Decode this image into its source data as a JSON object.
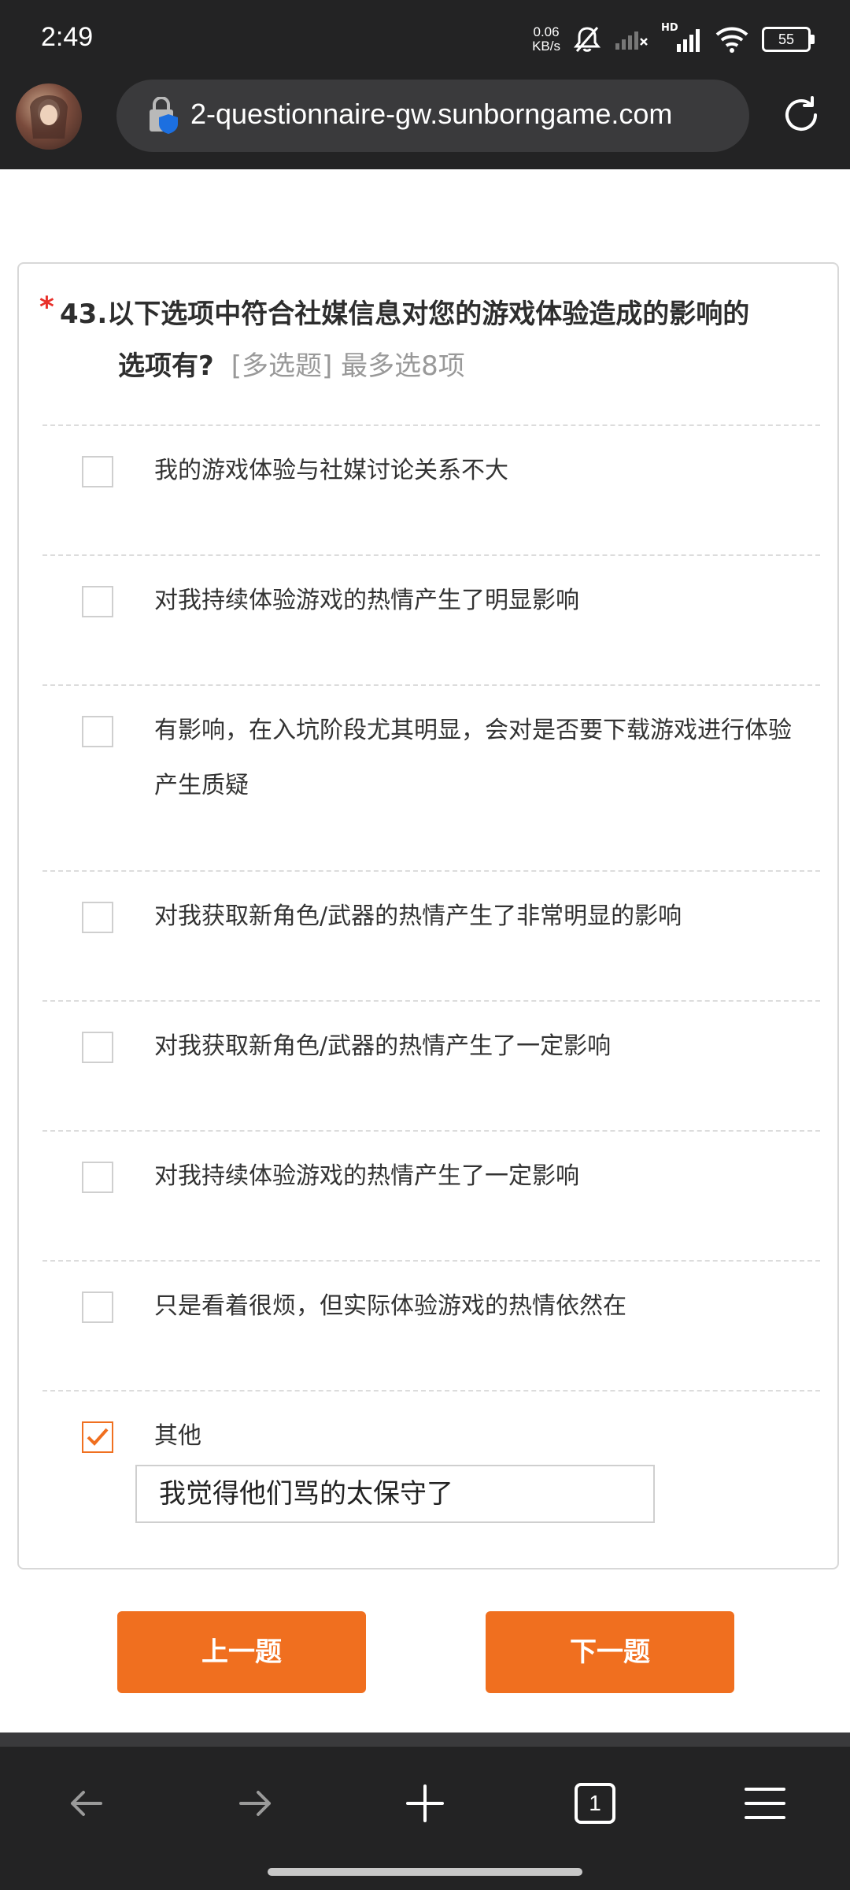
{
  "status_bar": {
    "time": "2:49",
    "net_speed_value": "0.06",
    "net_speed_unit": "KB/s",
    "hd_label": "HD",
    "battery": "55"
  },
  "browser": {
    "url": "2-questionnaire-gw.sunborngame.com",
    "tab_count": "1"
  },
  "question": {
    "required_mark": "*",
    "title_line1": "43.以下选项中符合社媒信息对您的游戏体验造成的影响的",
    "title_line2": "选项有?",
    "hint": "[多选题] 最多选8项",
    "options": [
      {
        "label": "我的游戏体验与社媒讨论关系不大",
        "checked": false
      },
      {
        "label": "对我持续体验游戏的热情产生了明显影响",
        "checked": false
      },
      {
        "label": "有影响，在入坑阶段尤其明显，会对是否要下载游戏进行体验产生质疑",
        "checked": false
      },
      {
        "label": "对我获取新角色/武器的热情产生了非常明显的影响",
        "checked": false
      },
      {
        "label": "对我获取新角色/武器的热情产生了一定影响",
        "checked": false
      },
      {
        "label": "对我持续体验游戏的热情产生了一定影响",
        "checked": false
      },
      {
        "label": "只是看着很烦，但实际体验游戏的热情依然在",
        "checked": false
      },
      {
        "label": "其他",
        "checked": true
      }
    ],
    "other_input_value": "我觉得他们骂的太保守了"
  },
  "navigation": {
    "prev_label": "上一题",
    "next_label": "下一题"
  },
  "colors": {
    "accent": "#f06f1f",
    "required": "#e8302a",
    "bars": "#232324"
  }
}
